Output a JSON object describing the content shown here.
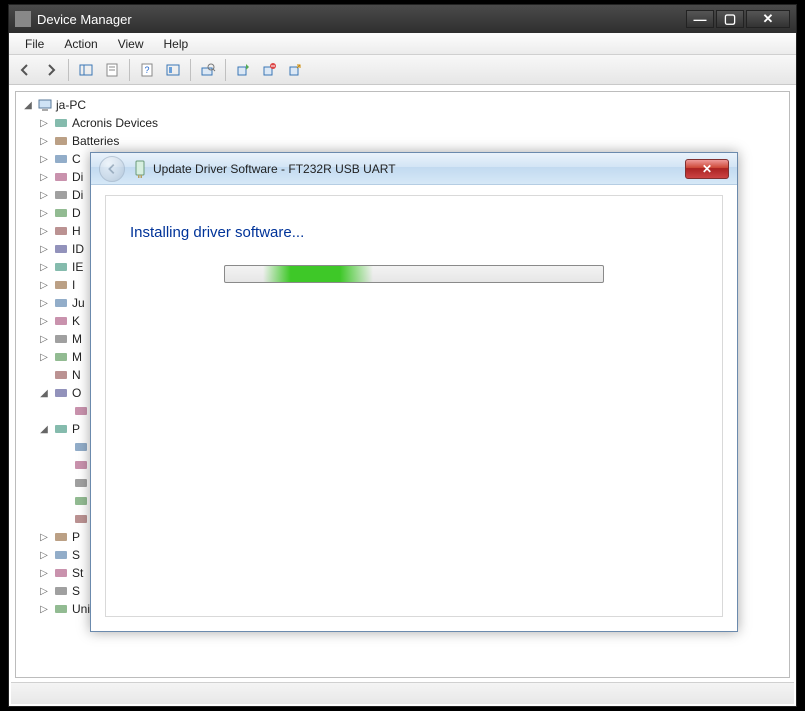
{
  "window": {
    "title": "Device Manager",
    "controls": {
      "min": "—",
      "max": "▢",
      "close": "✕"
    }
  },
  "menubar": [
    "File",
    "Action",
    "View",
    "Help"
  ],
  "tree": {
    "root": "ja-PC",
    "items": [
      {
        "label": "Acronis Devices",
        "expander": "▷"
      },
      {
        "label": "Batteries",
        "expander": "▷"
      },
      {
        "label": "C",
        "expander": "▷"
      },
      {
        "label": "Di",
        "expander": "▷"
      },
      {
        "label": "Di",
        "expander": "▷"
      },
      {
        "label": "D",
        "expander": "▷"
      },
      {
        "label": "H",
        "expander": "▷"
      },
      {
        "label": "ID",
        "expander": "▷"
      },
      {
        "label": "IE",
        "expander": "▷"
      },
      {
        "label": "I",
        "expander": "▷"
      },
      {
        "label": "Ju",
        "expander": "▷"
      },
      {
        "label": "K",
        "expander": "▷"
      },
      {
        "label": "M",
        "expander": "▷"
      },
      {
        "label": "M",
        "expander": "▷"
      },
      {
        "label": "N",
        "expander": ""
      },
      {
        "label": "O",
        "expander": "◢"
      },
      {
        "label": "P",
        "expander": "◢"
      },
      {
        "label": "P",
        "expander": "▷"
      },
      {
        "label": "S",
        "expander": "▷"
      },
      {
        "label": "St",
        "expander": "▷"
      },
      {
        "label": "S",
        "expander": "▷"
      },
      {
        "label": "Universal Serial Bus controllers",
        "expander": "▷"
      }
    ]
  },
  "dialog": {
    "title": "Update Driver Software - FT232R USB UART",
    "heading": "Installing driver software...",
    "close": "✕"
  }
}
